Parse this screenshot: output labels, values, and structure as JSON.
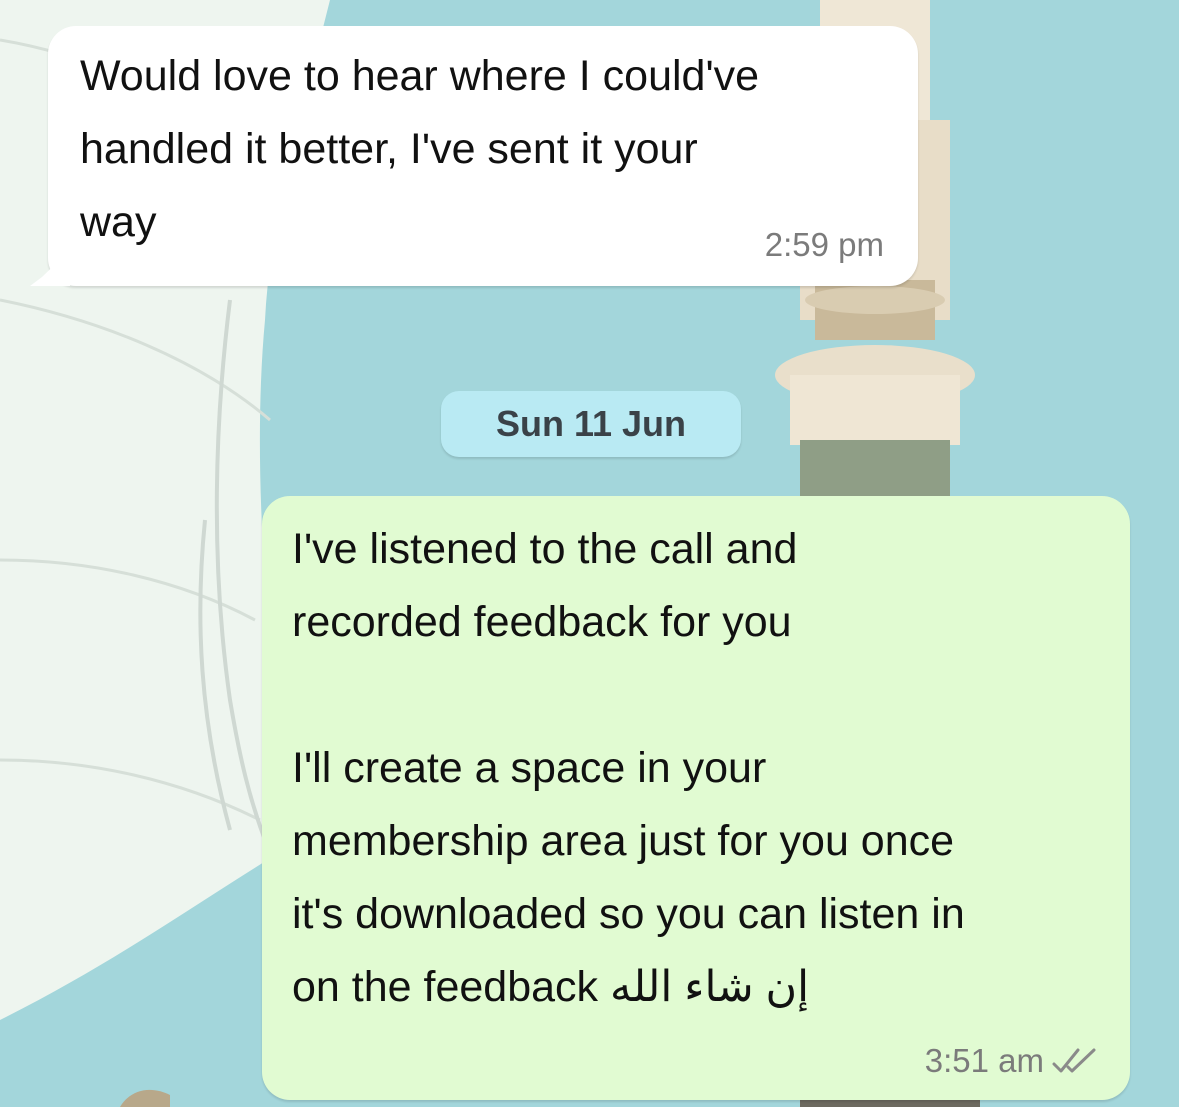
{
  "colors": {
    "wallpaper_sky": "#9fd3d8",
    "incoming_bubble": "#ffffff",
    "outgoing_bubble": "#e1fbd2",
    "date_pill": "#b9eaf3",
    "timestamp": "#7b7b7b"
  },
  "messages": [
    {
      "direction": "incoming",
      "text": "Would love to hear where I could've\nhandled it better, I've sent it your\nway",
      "time": "2:59 pm"
    },
    {
      "direction": "outgoing",
      "text": "I've listened to the call and\nrecorded feedback for you\n\nI'll create a space in your\nmembership area just for you once\nit's downloaded so you can listen in\non the feedback إن شاء الله",
      "time": "3:51 am",
      "status_icon": "double-check-read-icon"
    }
  ],
  "date_separator": "Sun 11 Jun",
  "wallpaper_icon": "minaret-wallpaper"
}
